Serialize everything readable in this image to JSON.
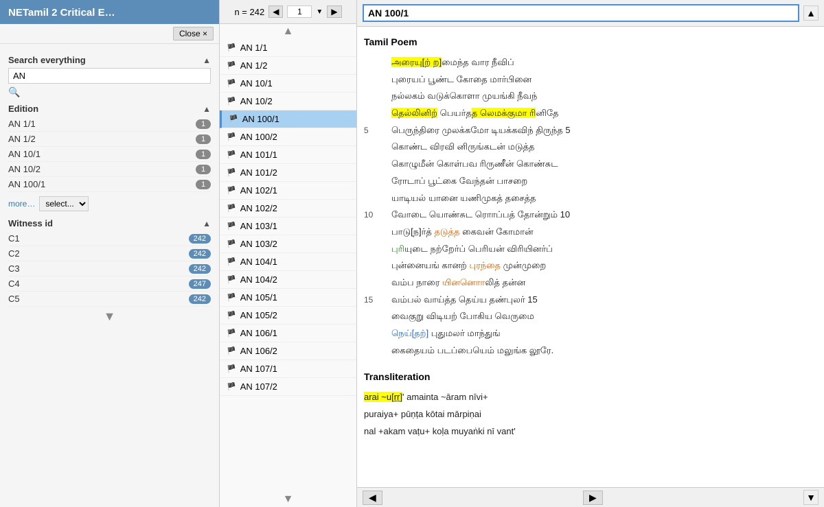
{
  "left_panel": {
    "title": "NETamil 2 Critical E…",
    "close_label": "Close ×",
    "search": {
      "title": "Search everything",
      "value": "AN",
      "placeholder": ""
    },
    "edition": {
      "title": "Edition",
      "items": [
        {
          "label": "AN 1/1",
          "count": "1"
        },
        {
          "label": "AN 1/2",
          "count": "1"
        },
        {
          "label": "AN 10/1",
          "count": "1"
        },
        {
          "label": "AN 10/2",
          "count": "1"
        },
        {
          "label": "AN 100/1",
          "count": "1"
        }
      ],
      "more_label": "more…",
      "select_default": "select..."
    },
    "witness": {
      "title": "Witness id",
      "items": [
        {
          "label": "C1",
          "count": "242"
        },
        {
          "label": "C2",
          "count": "242"
        },
        {
          "label": "C3",
          "count": "242"
        },
        {
          "label": "C4",
          "count": "247"
        },
        {
          "label": "C5",
          "count": "242"
        }
      ]
    }
  },
  "middle_panel": {
    "n_label": "n = 242",
    "page": "1",
    "items": [
      {
        "label": "AN 1/1"
      },
      {
        "label": "AN 1/2"
      },
      {
        "label": "AN 10/1"
      },
      {
        "label": "AN 10/2"
      },
      {
        "label": "AN 100/1",
        "active": true
      },
      {
        "label": "AN 100/2"
      },
      {
        "label": "AN 101/1"
      },
      {
        "label": "AN 101/2"
      },
      {
        "label": "AN 102/1"
      },
      {
        "label": "AN 102/2"
      },
      {
        "label": "AN 103/1"
      },
      {
        "label": "AN 103/2"
      },
      {
        "label": "AN 104/1"
      },
      {
        "label": "AN 104/2"
      },
      {
        "label": "AN 105/1"
      },
      {
        "label": "AN 105/2"
      },
      {
        "label": "AN 106/1"
      },
      {
        "label": "AN 106/2"
      },
      {
        "label": "AN 107/1"
      },
      {
        "label": "AN 107/2"
      }
    ]
  },
  "right_panel": {
    "title": "AN 100/1",
    "poem_section_title": "Tamil Poem",
    "transliteration_section_title": "Transliteration",
    "lines": [
      {
        "num": "",
        "text_html": "<span class='hl-yellow'>அரையு[ற் ற]</span>மைந்த வார நீவிப்"
      },
      {
        "num": "",
        "text_html": "புரையப் பூண்ட கோதை மார்பினை"
      },
      {
        "num": "",
        "text_html": "நல்லகம் வடுக்கொளா முயங்கி நீவந்"
      },
      {
        "num": "",
        "text_html": "<span class='hl-yellow'>தெல்லினிற்</span> பெயர்த<span class='hl-yellow'>த லெமக்குமா ரி</span>னிதே"
      },
      {
        "num": "5",
        "text_html": "பெருந்திரை முலக்கமோ டியக்கவிந் திருந்த 5"
      },
      {
        "num": "",
        "text_html": "கொண்ட விரவி னிருங்கடன் மடுத்த"
      },
      {
        "num": "",
        "text_html": "கொழுமீன் கொள்பவ ரிருணீன் கொண்சுட"
      },
      {
        "num": "",
        "text_html": "ரோடாப் பூட்கை வேந்தன் பாசறை"
      },
      {
        "num": "",
        "text_html": "யாடியல் யானை யணிமுகத் தசைத்த"
      },
      {
        "num": "10",
        "text_html": "வோடை யொண்சுட ரொாப்பத் தோன்றும் 10"
      },
      {
        "num": "",
        "text_html": "பாடு[ந]ர்த் <span class='hl-orange'>தடுத்த</span> கைவன் கோமான்"
      },
      {
        "num": "",
        "text_html": "<span class='hl-green'>புரி</span>யுடை நற்றேர்ப் பெரியன் விரியினர்ப்"
      },
      {
        "num": "",
        "text_html": "புன்னையங் கானற் <span class='hl-orange'>புரந்தை</span> முன்முறை"
      },
      {
        "num": "",
        "text_html": "வம்ப நாரை <span class='hl-orange'>யினனொா</span>லித் தன்ன"
      },
      {
        "num": "15",
        "text_html": "வம்பல் வாய்த்த தெய்ய தண்புலர் 15"
      },
      {
        "num": "",
        "text_html": "வைகுறு விடியற் போகிய வெருமை"
      },
      {
        "num": "",
        "text_html": "<span class='hl-blue'>நெய்[தற்]</span> புதுமலர் மாந்துங்"
      },
      {
        "num": "",
        "text_html": "கைதையம் படப்பையெம் மலுங்க லூரே."
      }
    ],
    "transliteration_lines": [
      {
        "text_html": "<span class='hl-yellow'>arai ~u[ṟṟ]</span>' amainta ~āram nīvi+"
      },
      {
        "text_html": "puraiya+ pūṇṭa kōtai mārpiṇai"
      },
      {
        "text_html": "nal +akam vaṭu+ koḷa muyaṅki nī vant'"
      }
    ]
  }
}
